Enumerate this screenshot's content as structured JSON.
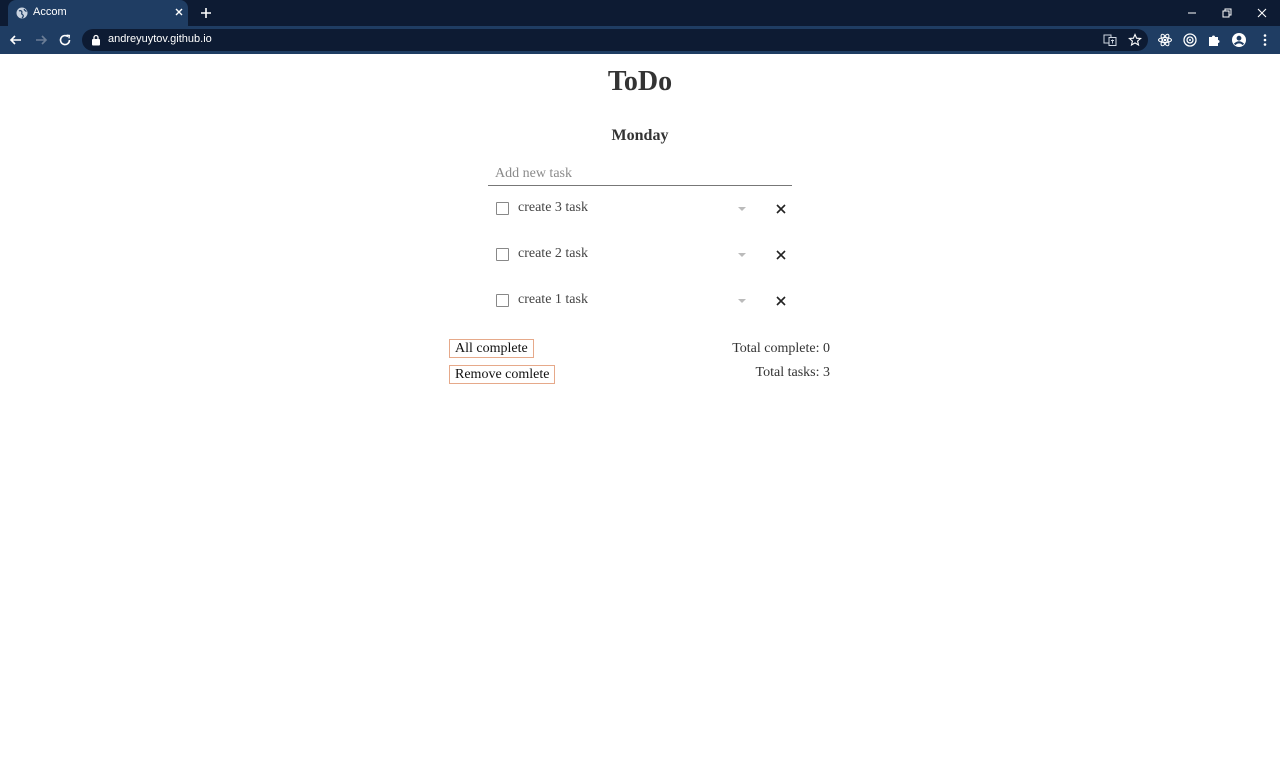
{
  "browser": {
    "tab_title": "Accom",
    "url": "andreyuytov.github.io"
  },
  "page": {
    "title": "ToDo",
    "day": "Monday",
    "new_task_placeholder": "Add new task",
    "tasks": [
      {
        "label": "create 3 task",
        "completed": false
      },
      {
        "label": "create 2 task",
        "completed": false
      },
      {
        "label": "create 1 task",
        "completed": false
      }
    ],
    "all_complete_label": "All complete",
    "remove_complete_label": "Remove comlete",
    "total_complete_text": "Total complete: 0",
    "total_tasks_text": "Total tasks: 3"
  },
  "colors": {
    "tabstrip_bg": "#0d1b33",
    "toolbar_bg": "#1f3d63",
    "button_border": "#e6a98a",
    "text": "#333333"
  },
  "icons": {
    "tab_favicon": "globe-icon",
    "tab_close": "close-icon",
    "new_tab": "plus-icon",
    "back": "back-arrow-icon",
    "forward": "forward-arrow-icon",
    "reload": "reload-icon",
    "lock": "lock-icon",
    "translate": "translate-icon",
    "bookmark": "star-icon",
    "extension_1": "react-icon",
    "extension_2": "target-icon",
    "extensions": "puzzle-icon",
    "profile": "profile-icon",
    "menu": "kebab-menu-icon",
    "task_dropdown": "dropdown-arrow-icon",
    "task_delete": "close-icon"
  }
}
